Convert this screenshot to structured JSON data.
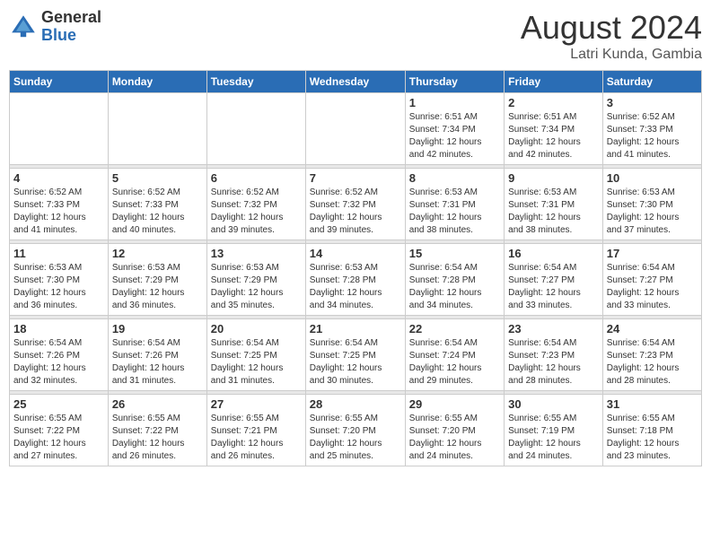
{
  "header": {
    "logo_general": "General",
    "logo_blue": "Blue",
    "month_year": "August 2024",
    "location": "Latri Kunda, Gambia"
  },
  "days_of_week": [
    "Sunday",
    "Monday",
    "Tuesday",
    "Wednesday",
    "Thursday",
    "Friday",
    "Saturday"
  ],
  "weeks": [
    [
      {
        "day": "",
        "info": ""
      },
      {
        "day": "",
        "info": ""
      },
      {
        "day": "",
        "info": ""
      },
      {
        "day": "",
        "info": ""
      },
      {
        "day": "1",
        "info": "Sunrise: 6:51 AM\nSunset: 7:34 PM\nDaylight: 12 hours\nand 42 minutes."
      },
      {
        "day": "2",
        "info": "Sunrise: 6:51 AM\nSunset: 7:34 PM\nDaylight: 12 hours\nand 42 minutes."
      },
      {
        "day": "3",
        "info": "Sunrise: 6:52 AM\nSunset: 7:33 PM\nDaylight: 12 hours\nand 41 minutes."
      }
    ],
    [
      {
        "day": "4",
        "info": "Sunrise: 6:52 AM\nSunset: 7:33 PM\nDaylight: 12 hours\nand 41 minutes."
      },
      {
        "day": "5",
        "info": "Sunrise: 6:52 AM\nSunset: 7:33 PM\nDaylight: 12 hours\nand 40 minutes."
      },
      {
        "day": "6",
        "info": "Sunrise: 6:52 AM\nSunset: 7:32 PM\nDaylight: 12 hours\nand 39 minutes."
      },
      {
        "day": "7",
        "info": "Sunrise: 6:52 AM\nSunset: 7:32 PM\nDaylight: 12 hours\nand 39 minutes."
      },
      {
        "day": "8",
        "info": "Sunrise: 6:53 AM\nSunset: 7:31 PM\nDaylight: 12 hours\nand 38 minutes."
      },
      {
        "day": "9",
        "info": "Sunrise: 6:53 AM\nSunset: 7:31 PM\nDaylight: 12 hours\nand 38 minutes."
      },
      {
        "day": "10",
        "info": "Sunrise: 6:53 AM\nSunset: 7:30 PM\nDaylight: 12 hours\nand 37 minutes."
      }
    ],
    [
      {
        "day": "11",
        "info": "Sunrise: 6:53 AM\nSunset: 7:30 PM\nDaylight: 12 hours\nand 36 minutes."
      },
      {
        "day": "12",
        "info": "Sunrise: 6:53 AM\nSunset: 7:29 PM\nDaylight: 12 hours\nand 36 minutes."
      },
      {
        "day": "13",
        "info": "Sunrise: 6:53 AM\nSunset: 7:29 PM\nDaylight: 12 hours\nand 35 minutes."
      },
      {
        "day": "14",
        "info": "Sunrise: 6:53 AM\nSunset: 7:28 PM\nDaylight: 12 hours\nand 34 minutes."
      },
      {
        "day": "15",
        "info": "Sunrise: 6:54 AM\nSunset: 7:28 PM\nDaylight: 12 hours\nand 34 minutes."
      },
      {
        "day": "16",
        "info": "Sunrise: 6:54 AM\nSunset: 7:27 PM\nDaylight: 12 hours\nand 33 minutes."
      },
      {
        "day": "17",
        "info": "Sunrise: 6:54 AM\nSunset: 7:27 PM\nDaylight: 12 hours\nand 33 minutes."
      }
    ],
    [
      {
        "day": "18",
        "info": "Sunrise: 6:54 AM\nSunset: 7:26 PM\nDaylight: 12 hours\nand 32 minutes."
      },
      {
        "day": "19",
        "info": "Sunrise: 6:54 AM\nSunset: 7:26 PM\nDaylight: 12 hours\nand 31 minutes."
      },
      {
        "day": "20",
        "info": "Sunrise: 6:54 AM\nSunset: 7:25 PM\nDaylight: 12 hours\nand 31 minutes."
      },
      {
        "day": "21",
        "info": "Sunrise: 6:54 AM\nSunset: 7:25 PM\nDaylight: 12 hours\nand 30 minutes."
      },
      {
        "day": "22",
        "info": "Sunrise: 6:54 AM\nSunset: 7:24 PM\nDaylight: 12 hours\nand 29 minutes."
      },
      {
        "day": "23",
        "info": "Sunrise: 6:54 AM\nSunset: 7:23 PM\nDaylight: 12 hours\nand 28 minutes."
      },
      {
        "day": "24",
        "info": "Sunrise: 6:54 AM\nSunset: 7:23 PM\nDaylight: 12 hours\nand 28 minutes."
      }
    ],
    [
      {
        "day": "25",
        "info": "Sunrise: 6:55 AM\nSunset: 7:22 PM\nDaylight: 12 hours\nand 27 minutes."
      },
      {
        "day": "26",
        "info": "Sunrise: 6:55 AM\nSunset: 7:22 PM\nDaylight: 12 hours\nand 26 minutes."
      },
      {
        "day": "27",
        "info": "Sunrise: 6:55 AM\nSunset: 7:21 PM\nDaylight: 12 hours\nand 26 minutes."
      },
      {
        "day": "28",
        "info": "Sunrise: 6:55 AM\nSunset: 7:20 PM\nDaylight: 12 hours\nand 25 minutes."
      },
      {
        "day": "29",
        "info": "Sunrise: 6:55 AM\nSunset: 7:20 PM\nDaylight: 12 hours\nand 24 minutes."
      },
      {
        "day": "30",
        "info": "Sunrise: 6:55 AM\nSunset: 7:19 PM\nDaylight: 12 hours\nand 24 minutes."
      },
      {
        "day": "31",
        "info": "Sunrise: 6:55 AM\nSunset: 7:18 PM\nDaylight: 12 hours\nand 23 minutes."
      }
    ]
  ]
}
